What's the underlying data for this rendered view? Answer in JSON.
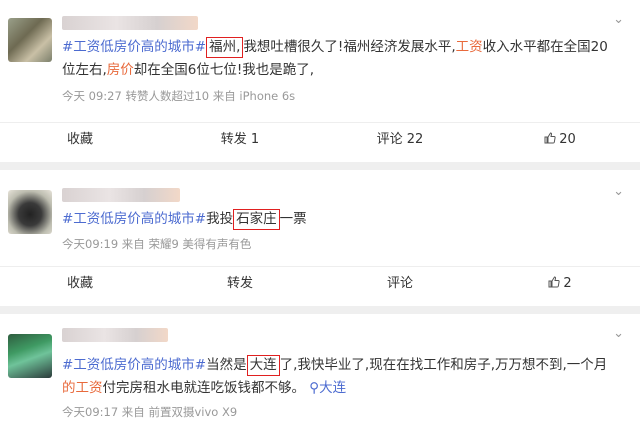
{
  "posts": [
    {
      "hashtag": "#工资低房价高的城市#",
      "text": [
        {
          "t": "福州,",
          "style": "boxed"
        },
        {
          "t": "我想吐槽很久了!福州经济发展水平,",
          "style": "plain"
        },
        {
          "t": "工资",
          "style": "red"
        },
        {
          "t": "收入水平都在全国20位左右,",
          "style": "plain"
        },
        {
          "t": "房价",
          "style": "red"
        },
        {
          "t": "却在全国6位七位!我也是跪了,",
          "style": "plain"
        }
      ],
      "meta": "今天 09:27 转赞人数超过10 来自 iPhone 6s",
      "actions": {
        "favorite": "收藏",
        "repost": "转发 1",
        "comment": "评论 22",
        "like": "20"
      }
    },
    {
      "hashtag": "#工资低房价高的城市#",
      "text": [
        {
          "t": "我投",
          "style": "plain"
        },
        {
          "t": "石家庄",
          "style": "boxed"
        },
        {
          "t": "一票",
          "style": "plain"
        }
      ],
      "meta": "今天09:19 来自 荣耀9 美得有声有色",
      "actions": {
        "favorite": "收藏",
        "repost": "转发",
        "comment": "评论",
        "like": "2"
      }
    },
    {
      "hashtag": "#工资低房价高的城市#",
      "text": [
        {
          "t": "当然是",
          "style": "plain"
        },
        {
          "t": "大连",
          "style": "boxed"
        },
        {
          "t": "了,我快毕业了,现在在找工作和房子,万万想不到,一个月",
          "style": "plain"
        },
        {
          "t": "的工资",
          "style": "red"
        },
        {
          "t": "付完房租水电就连吃饭钱都不够。",
          "style": "plain"
        },
        {
          "t": " ⚲大连",
          "style": "loc"
        }
      ],
      "meta": "今天09:17 来自 前置双摄vivo X9",
      "actions": null
    }
  ],
  "icons": {
    "more": "chevron-down-icon",
    "like": "thumbs-up-icon",
    "location": "location-pin-icon"
  },
  "colors": {
    "hashtag": "#4c6bd0",
    "keyword": "#e86a3c",
    "highlight_box": "#e02020",
    "meta": "#999999"
  }
}
